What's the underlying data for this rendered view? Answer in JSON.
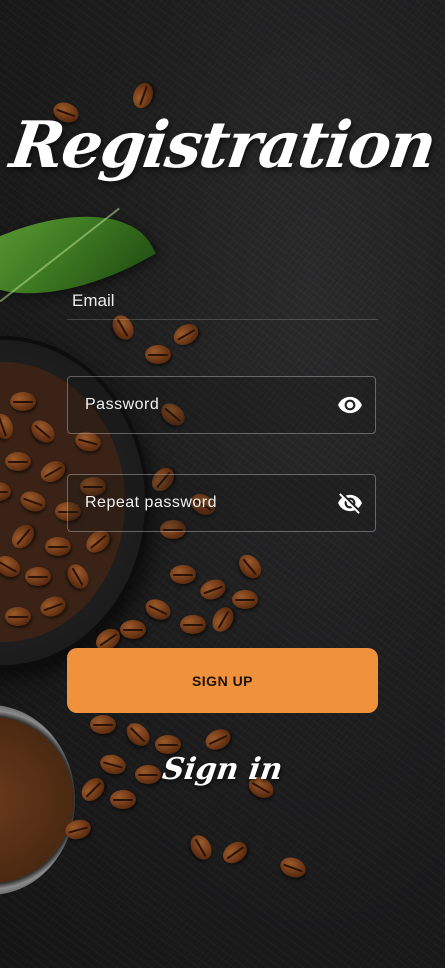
{
  "header": {
    "title": "Registration"
  },
  "form": {
    "email_label": "Email",
    "password_placeholder": "Password",
    "repeat_password_placeholder": "Repeat password"
  },
  "actions": {
    "signup_label": "SIGN UP",
    "signin_label": "Sign in"
  },
  "icons": {
    "password_toggle": "eye-icon",
    "repeat_password_toggle": "eye-off-icon"
  },
  "colors": {
    "accent": "#f0923c",
    "background": "#1b1b1c",
    "text": "#ffffff"
  }
}
